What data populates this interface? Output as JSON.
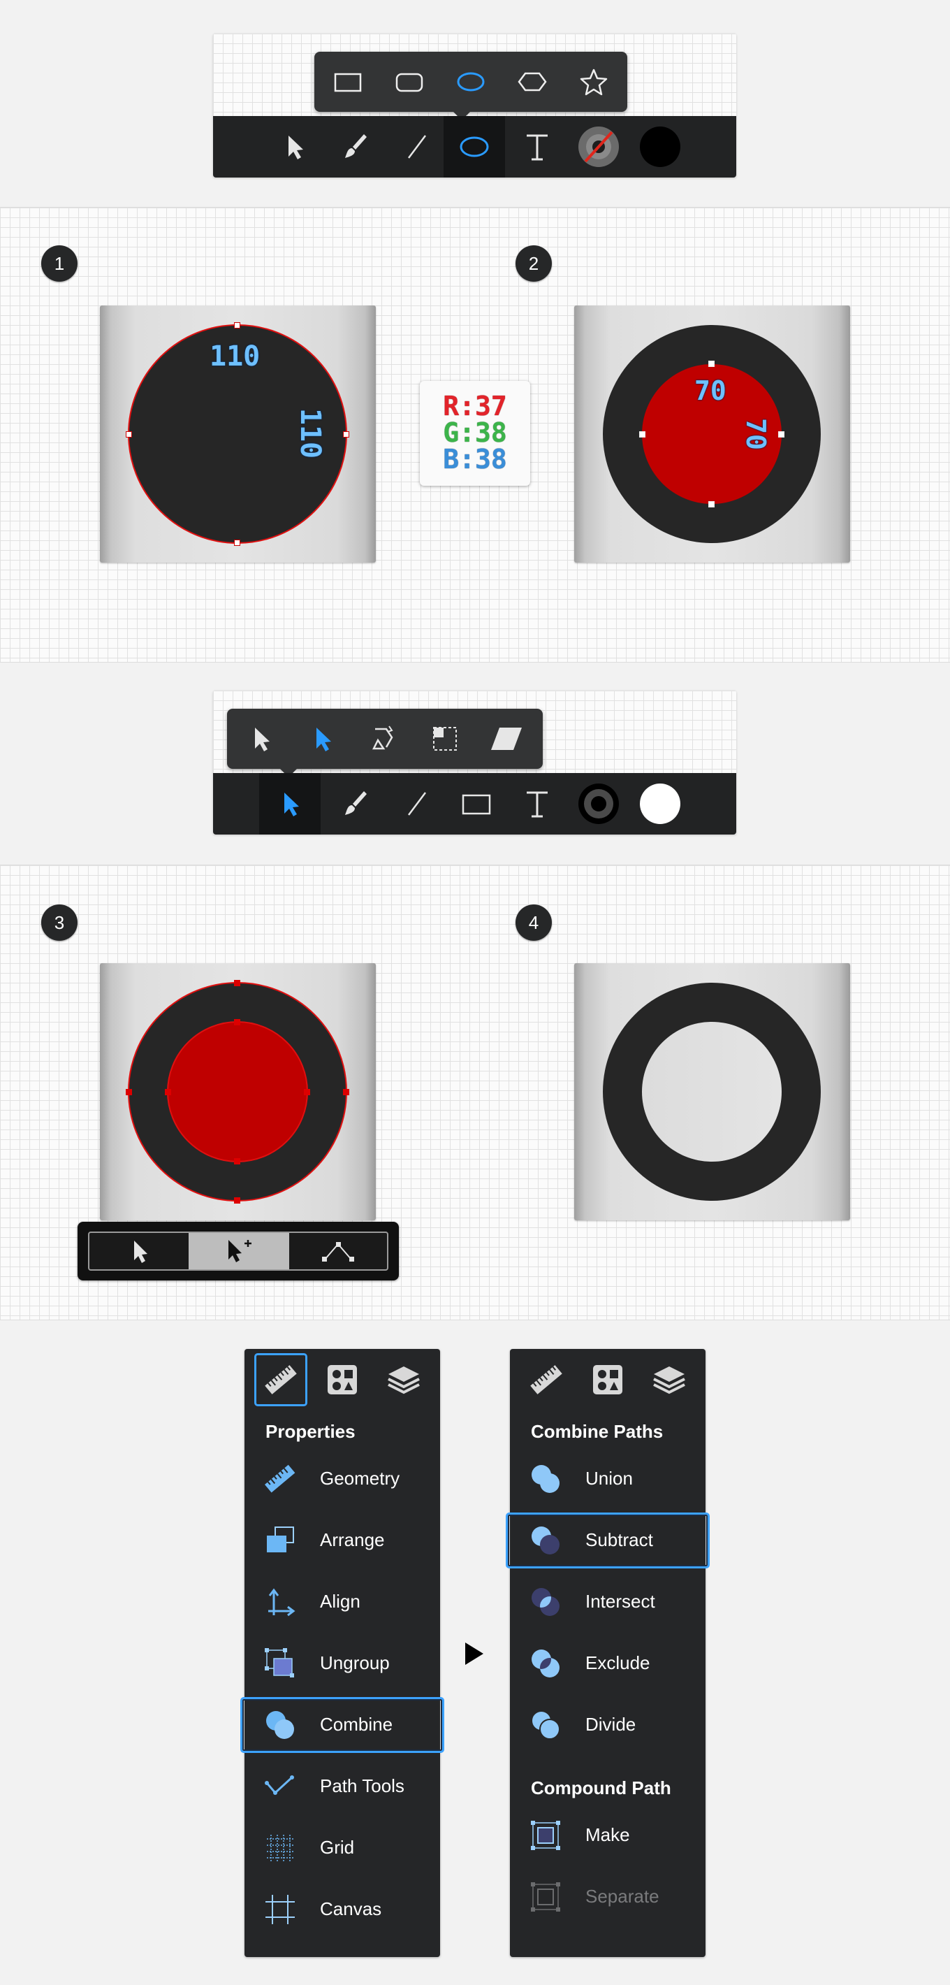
{
  "toolbar1": {
    "shapes_popup": [
      "rectangle-shape-icon",
      "rounded-rectangle-shape-icon",
      "ellipse-shape-icon",
      "polygon-shape-icon",
      "star-shape-icon"
    ],
    "tools": [
      "select-arrow-icon",
      "brush-icon",
      "line-icon",
      "ellipse-icon",
      "text-icon",
      "stroke-color-icon",
      "fill-color-icon"
    ],
    "active_tool": "ellipse-icon",
    "stroke_color": "#555555",
    "fill_color": "#000000"
  },
  "step1": {
    "badge": "1",
    "width_label": "110",
    "height_label": "110",
    "circle_fill": "#262626",
    "outline": "#e01010"
  },
  "color_swatch": {
    "r": "R:37",
    "g": "G:38",
    "b": "B:38"
  },
  "step2": {
    "badge": "2",
    "width_label": "70",
    "height_label": "70",
    "inner_fill": "#bf0000"
  },
  "toolbar2": {
    "select_popup": [
      "select-arrow-icon",
      "direct-select-arrow-icon",
      "rotate-icon",
      "transform-icon",
      "skew-icon"
    ],
    "tools": [
      "direct-select-icon",
      "brush-icon",
      "line-icon",
      "rectangle-icon",
      "text-icon",
      "stroke-color-icon",
      "fill-color-icon"
    ],
    "active_tool": "direct-select-icon",
    "stroke_color": "#000000",
    "fill_color": "#ffffff"
  },
  "step3": {
    "badge": "3",
    "mini_toolbar": [
      "select-icon",
      "add-select-icon",
      "node-icon"
    ],
    "active_mini": "add-select-icon"
  },
  "step4": {
    "badge": "4"
  },
  "menu_left": {
    "tabs": [
      "ruler-icon",
      "shapes-icon",
      "layers-icon"
    ],
    "active_tab": "ruler-icon",
    "heading": "Properties",
    "items": [
      {
        "label": "Geometry",
        "icon": "ruler-icon"
      },
      {
        "label": "Arrange",
        "icon": "arrange-icon"
      },
      {
        "label": "Align",
        "icon": "align-icon"
      },
      {
        "label": "Ungroup",
        "icon": "ungroup-icon"
      },
      {
        "label": "Combine",
        "icon": "combine-icon"
      },
      {
        "label": "Path Tools",
        "icon": "path-tools-icon"
      },
      {
        "label": "Grid",
        "icon": "grid-icon"
      },
      {
        "label": "Canvas",
        "icon": "canvas-icon"
      }
    ],
    "selected": "Combine"
  },
  "menu_right": {
    "tabs": [
      "ruler-icon",
      "shapes-icon",
      "layers-icon"
    ],
    "heading1": "Combine Paths",
    "items": [
      {
        "label": "Union",
        "icon": "union-icon"
      },
      {
        "label": "Subtract",
        "icon": "subtract-icon"
      },
      {
        "label": "Intersect",
        "icon": "intersect-icon"
      },
      {
        "label": "Exclude",
        "icon": "exclude-icon"
      },
      {
        "label": "Divide",
        "icon": "divide-icon"
      }
    ],
    "selected": "Subtract",
    "heading2": "Compound Path",
    "compound_items": [
      {
        "label": "Make",
        "icon": "make-compound-icon",
        "enabled": true
      },
      {
        "label": "Separate",
        "icon": "separate-compound-icon",
        "enabled": false
      }
    ]
  },
  "accent_color": "#3ca2ff"
}
